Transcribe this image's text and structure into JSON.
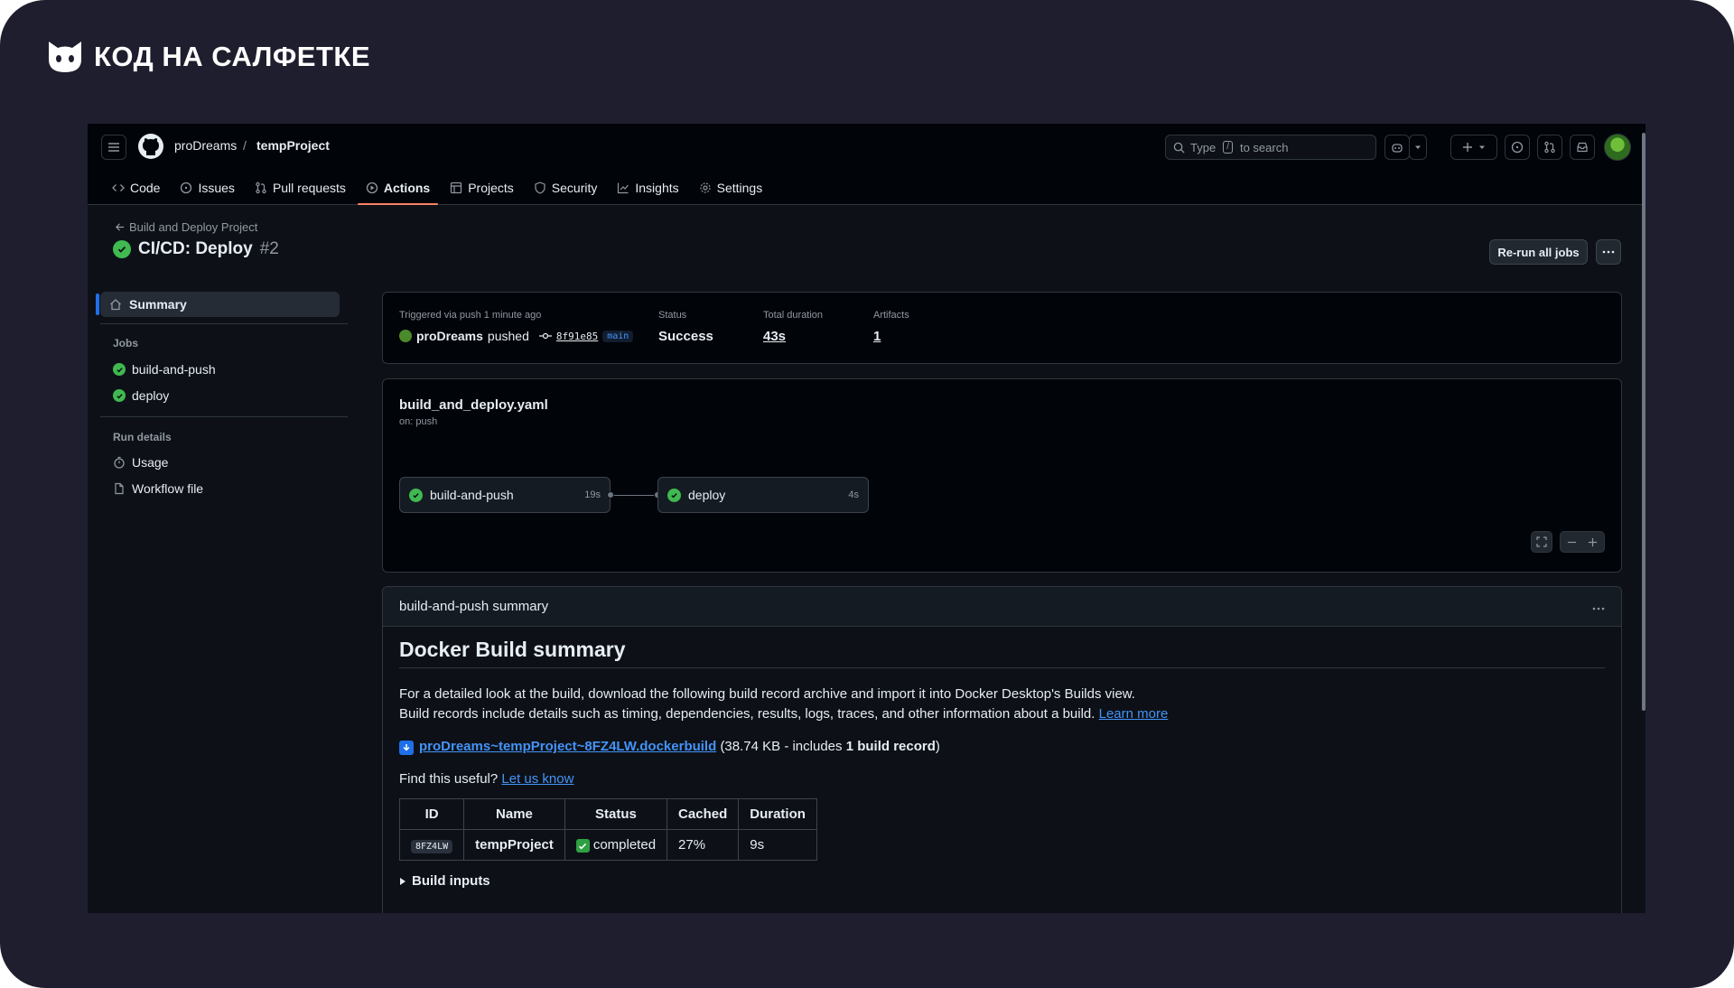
{
  "brand": {
    "name": "КОД НА САЛФЕТКЕ"
  },
  "header": {
    "owner": "proDreams",
    "separator": "/",
    "repo": "tempProject",
    "search": {
      "prefix": "Type",
      "key": "/",
      "suffix": "to search"
    }
  },
  "tabs": [
    {
      "label": "Code",
      "icon": "code-icon"
    },
    {
      "label": "Issues",
      "icon": "issue-icon"
    },
    {
      "label": "Pull requests",
      "icon": "pull-request-icon"
    },
    {
      "label": "Actions",
      "icon": "play-icon",
      "active": true
    },
    {
      "label": "Projects",
      "icon": "table-icon"
    },
    {
      "label": "Security",
      "icon": "shield-icon"
    },
    {
      "label": "Insights",
      "icon": "graph-icon"
    },
    {
      "label": "Settings",
      "icon": "gear-icon"
    }
  ],
  "run": {
    "back_label": "Build and Deploy Project",
    "title": "CI/CD: Deploy",
    "number": "#2",
    "rerun_label": "Re-run all jobs"
  },
  "sidebar": {
    "summary_label": "Summary",
    "jobs_heading": "Jobs",
    "jobs": [
      "build-and-push",
      "deploy"
    ],
    "run_details_heading": "Run details",
    "details": [
      {
        "label": "Usage",
        "icon": "stopwatch-icon"
      },
      {
        "label": "Workflow file",
        "icon": "file-icon"
      }
    ]
  },
  "meta": {
    "trigger_label": "Triggered via push 1 minute ago",
    "actor": "proDreams",
    "action": "pushed",
    "sha": "8f91e85",
    "branch": "main",
    "status_label": "Status",
    "status_value": "Success",
    "duration_label": "Total duration",
    "duration_value": "43s",
    "artifacts_label": "Artifacts",
    "artifacts_value": "1"
  },
  "workflow": {
    "file": "build_and_deploy.yaml",
    "trigger": "on: push",
    "jobs": [
      {
        "name": "build-and-push",
        "duration": "19s"
      },
      {
        "name": "deploy",
        "duration": "4s"
      }
    ]
  },
  "summary": {
    "heading": "build-and-push summary",
    "title": "Docker Build summary",
    "line1": "For a detailed look at the build, download the following build record archive and import it into Docker Desktop's Builds view.",
    "line2": "Build records include details such as timing, dependencies, results, logs, traces, and other information about a build.",
    "learn_more": "Learn more",
    "download_link": "proDreams~tempProject~8FZ4LW.dockerbuild",
    "download_info_pre": "(38.74 KB - includes ",
    "download_info_bold": "1 build record",
    "download_info_post": ")",
    "useful_q": "Find this useful?",
    "useful_link": "Let us know",
    "table": {
      "headers": [
        "ID",
        "Name",
        "Status",
        "Cached",
        "Duration"
      ],
      "row": {
        "id": "8FZ4LW",
        "name": "tempProject",
        "status": "completed",
        "cached": "27%",
        "duration": "9s"
      }
    },
    "build_inputs": "Build inputs"
  }
}
